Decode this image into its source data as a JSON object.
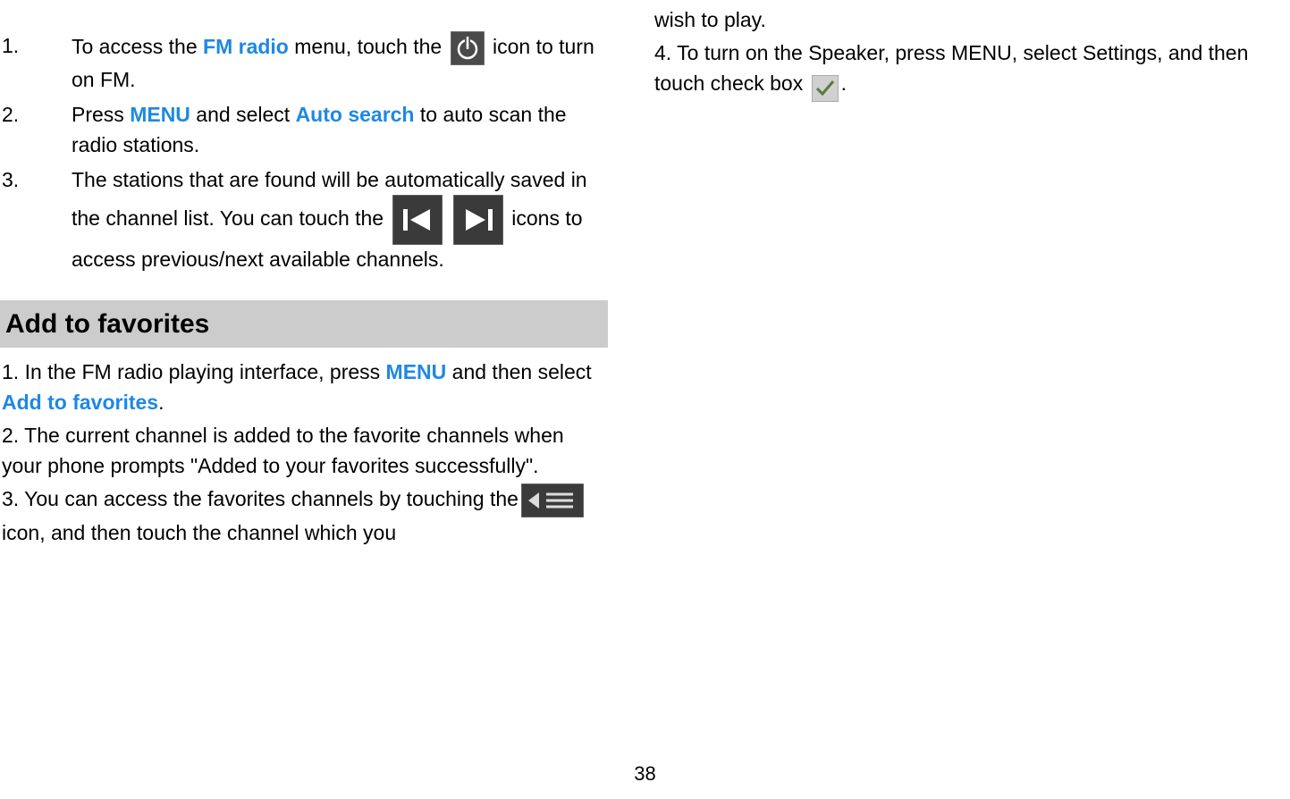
{
  "leftColumn": {
    "list": [
      {
        "num": "1.",
        "parts": {
          "t1": "To access the ",
          "hl1": "FM radio",
          "t2": " menu, touch the ",
          "t3": " icon to turn on FM."
        }
      },
      {
        "num": "2.",
        "parts": {
          "t1": "Press ",
          "hl1": "MENU",
          "t2": " and select ",
          "hl2": "Auto search",
          "t3": " to auto scan the radio stations."
        }
      },
      {
        "num": "3.",
        "parts": {
          "t1": "The stations that are found will be automatically saved in the channel list. You can touch the ",
          "t2": " icons to access previous/next available channels."
        }
      }
    ],
    "sectionHeader": "Add to favorites",
    "favBody": {
      "p1a": "1. In the FM radio playing interface, press ",
      "p1hl1": "MENU",
      "p1b": " and then select ",
      "p1hl2": "Add to favorites",
      "p1c": ".",
      "p2": "2. The current channel is added to the favorite channels when your phone prompts \"Added to your favorites successfully\".",
      "p3a": "3. You can access the favorites channels by touching the",
      "p3b": "   icon, and then touch the channel which you"
    }
  },
  "rightColumn": {
    "p1": "wish to play.",
    "p2a": "4. To turn on the Speaker, press MENU, select Settings, and then touch check box ",
    "p2b": "."
  },
  "pageNumber": "38"
}
